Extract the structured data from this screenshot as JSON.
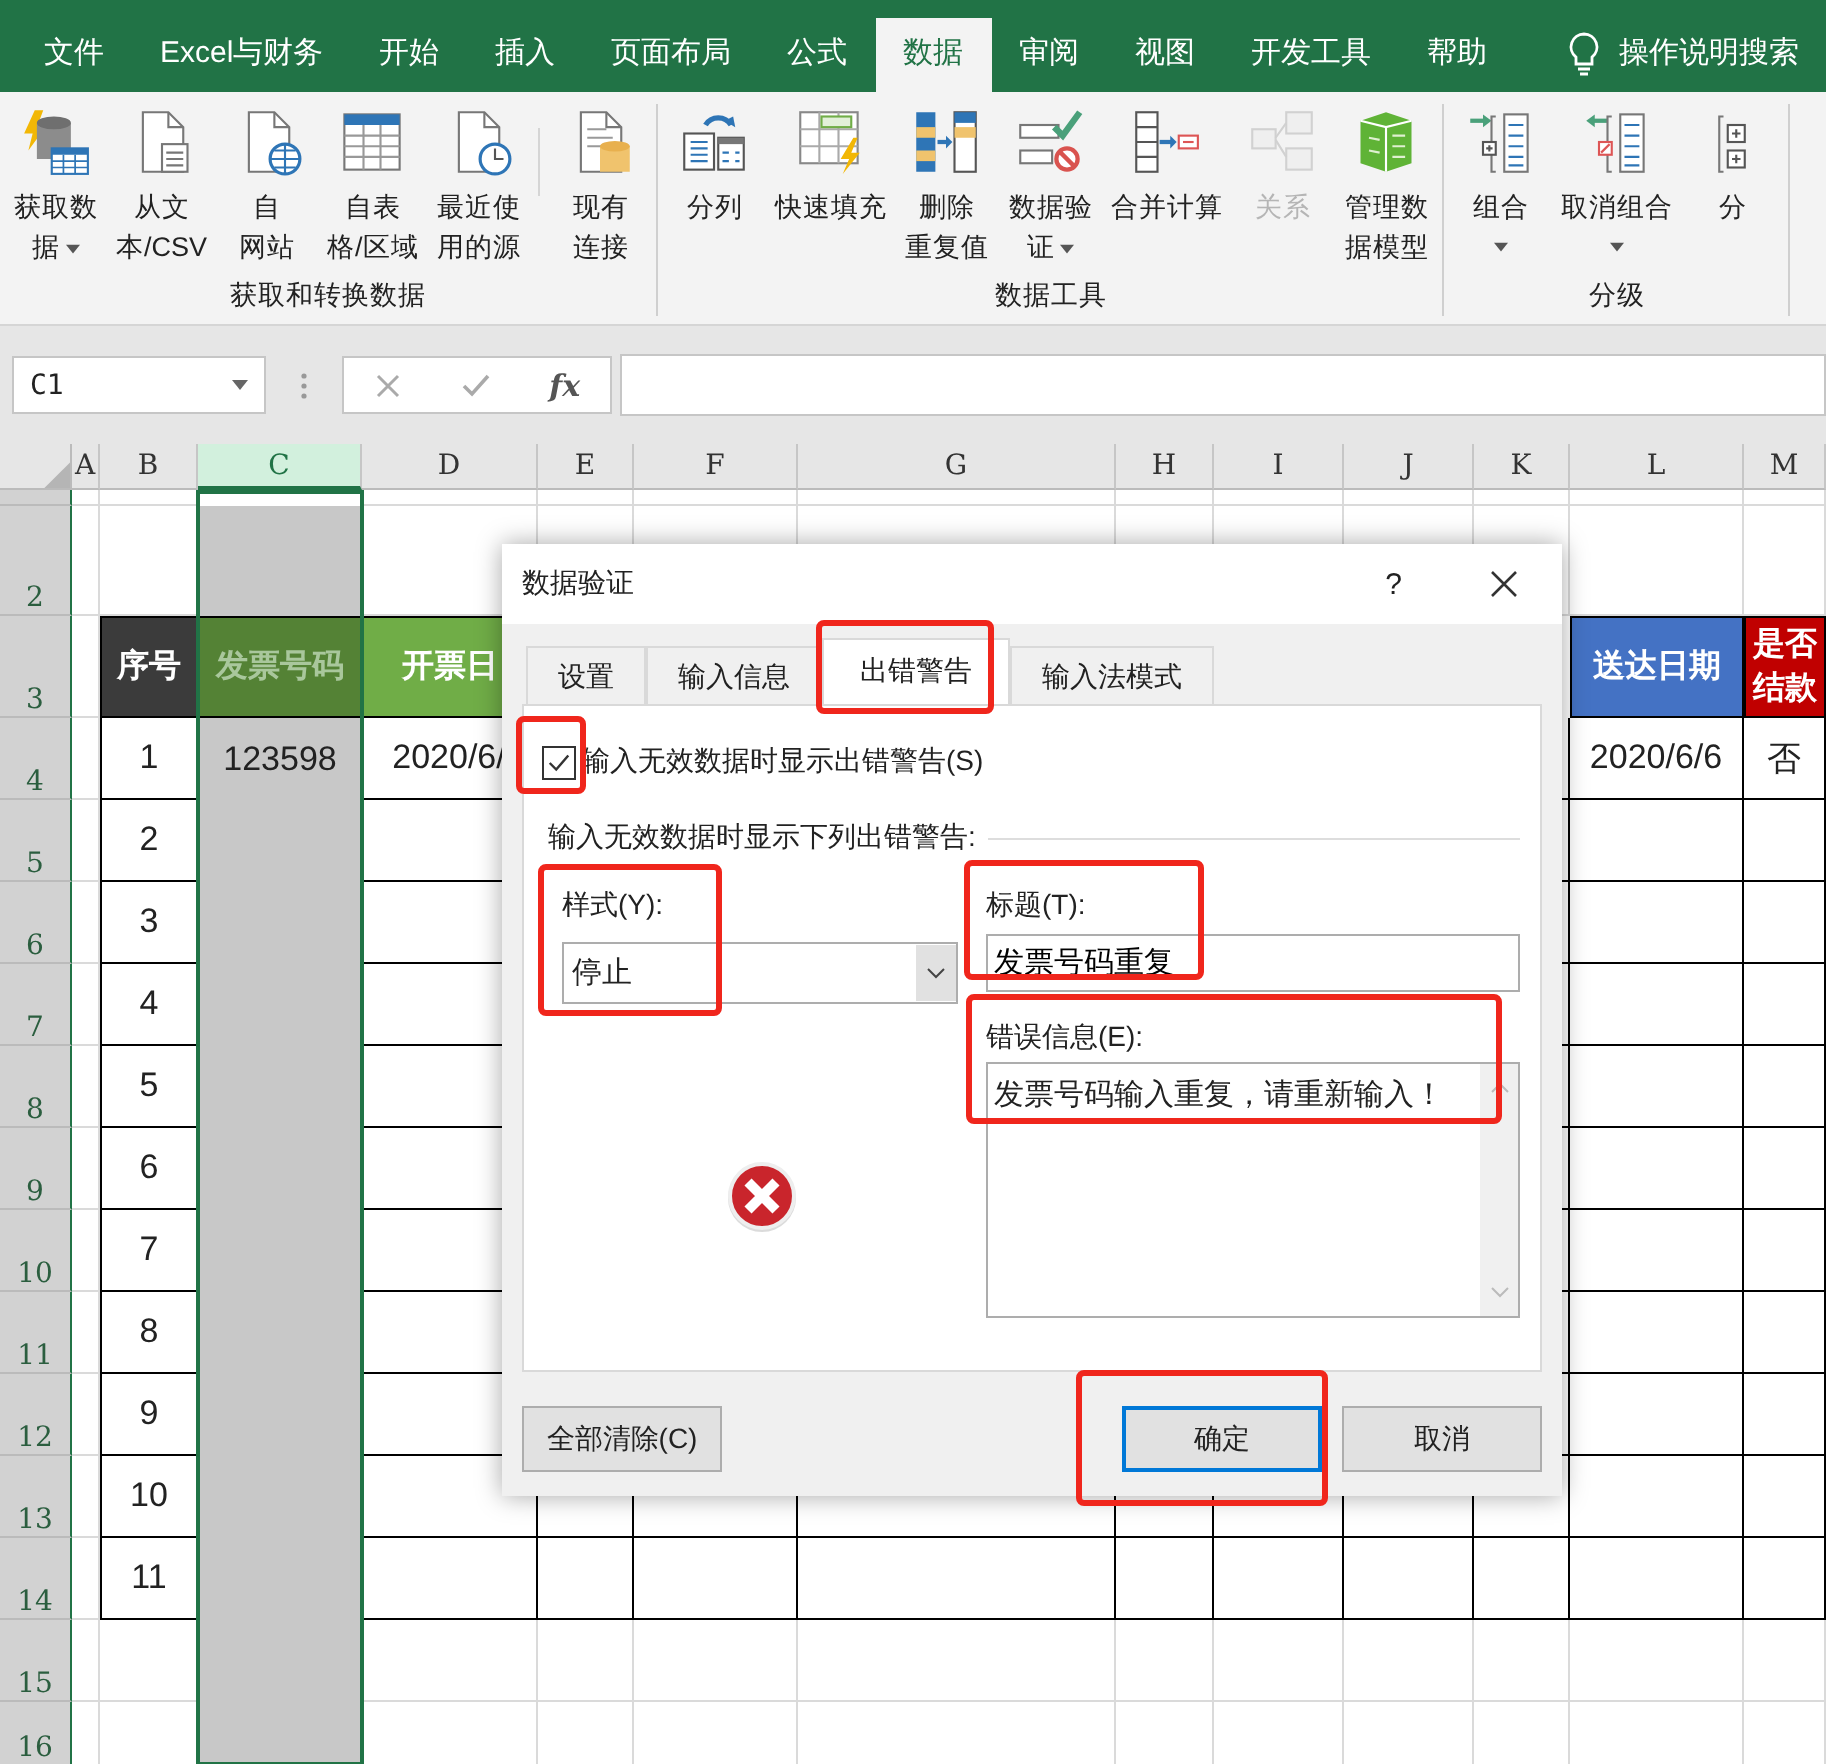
{
  "ribbon": {
    "tabs": [
      {
        "label": "文件",
        "selected": false
      },
      {
        "label": "Excel与财务",
        "selected": false
      },
      {
        "label": "开始",
        "selected": false
      },
      {
        "label": "插入",
        "selected": false
      },
      {
        "label": "页面布局",
        "selected": false
      },
      {
        "label": "公式",
        "selected": false
      },
      {
        "label": "数据",
        "selected": true
      },
      {
        "label": "审阅",
        "selected": false
      },
      {
        "label": "视图",
        "selected": false
      },
      {
        "label": "开发工具",
        "selected": false
      },
      {
        "label": "帮助",
        "selected": false
      }
    ],
    "search": {
      "label": "操作说明搜索"
    },
    "groups": [
      {
        "label": "获取和转换数据",
        "button_sets": [
          [
            {
              "lines": [
                "获取数",
                "据"
              ],
              "dropdown": true,
              "disabled": false
            },
            {
              "lines": [
                "从文",
                "本/CSV"
              ],
              "dropdown": false,
              "disabled": false
            },
            {
              "lines": [
                "自",
                "网站"
              ],
              "dropdown": false,
              "disabled": false
            },
            {
              "lines": [
                "自表",
                "格/区域"
              ],
              "dropdown": false,
              "disabled": false
            },
            {
              "lines": [
                "最近使",
                "用的源"
              ],
              "dropdown": false,
              "disabled": false
            }
          ],
          [
            {
              "lines": [
                "现有",
                "连接"
              ],
              "dropdown": false,
              "disabled": false
            }
          ]
        ]
      },
      {
        "label": "数据工具",
        "button_sets": [
          [
            {
              "lines": [
                "分列"
              ],
              "dropdown": false,
              "disabled": false
            },
            {
              "lines": [
                "快速填充"
              ],
              "dropdown": false,
              "disabled": false
            },
            {
              "lines": [
                "删除",
                "重复值"
              ],
              "dropdown": false,
              "disabled": false
            },
            {
              "lines": [
                "数据验",
                "证"
              ],
              "dropdown": true,
              "disabled": false
            },
            {
              "lines": [
                "合并计算"
              ],
              "dropdown": false,
              "disabled": false
            },
            {
              "lines": [
                "关系"
              ],
              "dropdown": false,
              "disabled": true
            },
            {
              "lines": [
                "管理数",
                "据模型"
              ],
              "dropdown": false,
              "disabled": false
            }
          ]
        ]
      },
      {
        "label": "分级",
        "button_sets": [
          [
            {
              "lines": [
                "组合"
              ],
              "dropdown": true,
              "disabled": false
            },
            {
              "lines": [
                "取消组合"
              ],
              "dropdown": true,
              "disabled": false
            },
            {
              "lines": [
                "分"
              ],
              "dropdown": false,
              "disabled": false
            }
          ]
        ]
      }
    ]
  },
  "formula_bar": {
    "name_box": "C1",
    "function_label": "fx"
  },
  "sheet": {
    "column_headers": [
      {
        "label": "A",
        "selected": false
      },
      {
        "label": "B",
        "selected": false
      },
      {
        "label": "C",
        "selected": true
      },
      {
        "label": "D",
        "selected": false
      },
      {
        "label": "E",
        "selected": false
      },
      {
        "label": "F",
        "selected": false
      },
      {
        "label": "G",
        "selected": false
      },
      {
        "label": "H",
        "selected": false
      },
      {
        "label": "I",
        "selected": false
      },
      {
        "label": "J",
        "selected": false
      },
      {
        "label": "K",
        "selected": false
      },
      {
        "label": "L",
        "selected": false
      },
      {
        "label": "M",
        "selected": false
      }
    ],
    "row_headers": [
      "2",
      "3",
      "4",
      "5",
      "6",
      "7",
      "8",
      "9",
      "10",
      "11",
      "12",
      "13",
      "14",
      "15",
      "16"
    ],
    "table": {
      "headers": [
        {
          "lines": [
            "序号"
          ],
          "color": "#3b3b3b"
        },
        {
          "lines": [
            "发票号码"
          ],
          "color": "#548235"
        },
        {
          "lines": [
            "开票日"
          ],
          "color": "#70ad47"
        },
        {
          "lines": [
            "送达日期"
          ],
          "color": "#4472c4"
        },
        {
          "lines": [
            "是否",
            "结款"
          ],
          "color": "#c00000"
        }
      ],
      "rows": [
        {
          "seq": "1",
          "invoice_no": "123598",
          "issue_date": "2020/6/",
          "delivery_date": "2020/6/6",
          "settled": "否"
        },
        {
          "seq": "2"
        },
        {
          "seq": "3"
        },
        {
          "seq": "4"
        },
        {
          "seq": "5"
        },
        {
          "seq": "6"
        },
        {
          "seq": "7"
        },
        {
          "seq": "8"
        },
        {
          "seq": "9"
        },
        {
          "seq": "10"
        },
        {
          "seq": "11"
        }
      ]
    }
  },
  "dialog": {
    "title": "数据验证",
    "help": "?",
    "tabs": [
      {
        "label": "设置",
        "selected": false
      },
      {
        "label": "输入信息",
        "selected": false
      },
      {
        "label": "出错警告",
        "selected": true
      },
      {
        "label": "输入法模式",
        "selected": false
      }
    ],
    "show_alert": {
      "label": "输入无效数据时显示出错警告(S)",
      "checked": true
    },
    "section_label": "输入无效数据时显示下列出错警告:",
    "style": {
      "label": "样式(Y):",
      "value": "停止"
    },
    "title_field": {
      "label": "标题(T):",
      "value": "发票号码重复"
    },
    "message": {
      "label": "错误信息(E):",
      "value": "发票号码输入重复，请重新输入！"
    },
    "buttons": [
      {
        "label": "全部清除(C)",
        "default": false
      },
      {
        "label": "确定",
        "default": true
      },
      {
        "label": "取消",
        "default": false
      }
    ]
  }
}
